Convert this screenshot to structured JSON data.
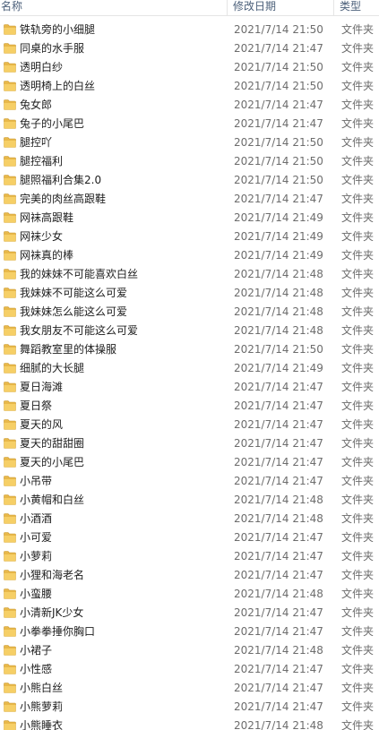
{
  "columns": {
    "name": "名称",
    "date_modified": "修改日期",
    "type": "类型"
  },
  "icon": "folder-icon",
  "folder_color": "#e8b84a",
  "rows": [
    {
      "name": "铁轨旁的小细腿",
      "date": "2021/7/14 21:50",
      "type": "文件夹"
    },
    {
      "name": "同桌的水手服",
      "date": "2021/7/14 21:47",
      "type": "文件夹"
    },
    {
      "name": "透明白纱",
      "date": "2021/7/14 21:50",
      "type": "文件夹"
    },
    {
      "name": "透明椅上的白丝",
      "date": "2021/7/14 21:50",
      "type": "文件夹"
    },
    {
      "name": "兔女郎",
      "date": "2021/7/14 21:47",
      "type": "文件夹"
    },
    {
      "name": "兔子的小尾巴",
      "date": "2021/7/14 21:47",
      "type": "文件夹"
    },
    {
      "name": "腿控吖",
      "date": "2021/7/14 21:50",
      "type": "文件夹"
    },
    {
      "name": "腿控福利",
      "date": "2021/7/14 21:50",
      "type": "文件夹"
    },
    {
      "name": "腿照福利合集2.0",
      "date": "2021/7/14 21:50",
      "type": "文件夹"
    },
    {
      "name": "完美的肉丝高跟鞋",
      "date": "2021/7/14 21:47",
      "type": "文件夹"
    },
    {
      "name": "网袜高跟鞋",
      "date": "2021/7/14 21:49",
      "type": "文件夹"
    },
    {
      "name": "网袜少女",
      "date": "2021/7/14 21:49",
      "type": "文件夹"
    },
    {
      "name": "网袜真的棒",
      "date": "2021/7/14 21:49",
      "type": "文件夹"
    },
    {
      "name": "我的妹妹不可能喜欢白丝",
      "date": "2021/7/14 21:48",
      "type": "文件夹"
    },
    {
      "name": "我妹妹不可能这么可爱",
      "date": "2021/7/14 21:48",
      "type": "文件夹"
    },
    {
      "name": "我妹妹怎么能这么可爱",
      "date": "2021/7/14 21:48",
      "type": "文件夹"
    },
    {
      "name": "我女朋友不可能这么可爱",
      "date": "2021/7/14 21:48",
      "type": "文件夹"
    },
    {
      "name": "舞蹈教室里的体操服",
      "date": "2021/7/14 21:50",
      "type": "文件夹"
    },
    {
      "name": "细腻的大长腿",
      "date": "2021/7/14 21:49",
      "type": "文件夹"
    },
    {
      "name": "夏日海滩",
      "date": "2021/7/14 21:47",
      "type": "文件夹"
    },
    {
      "name": "夏日祭",
      "date": "2021/7/14 21:47",
      "type": "文件夹"
    },
    {
      "name": "夏天的风",
      "date": "2021/7/14 21:47",
      "type": "文件夹"
    },
    {
      "name": "夏天的甜甜圈",
      "date": "2021/7/14 21:47",
      "type": "文件夹"
    },
    {
      "name": "夏天的小尾巴",
      "date": "2021/7/14 21:47",
      "type": "文件夹"
    },
    {
      "name": "小吊带",
      "date": "2021/7/14 21:47",
      "type": "文件夹"
    },
    {
      "name": "小黄帽和白丝",
      "date": "2021/7/14 21:48",
      "type": "文件夹"
    },
    {
      "name": "小酒酒",
      "date": "2021/7/14 21:48",
      "type": "文件夹"
    },
    {
      "name": "小可爱",
      "date": "2021/7/14 21:47",
      "type": "文件夹"
    },
    {
      "name": "小萝莉",
      "date": "2021/7/14 21:47",
      "type": "文件夹"
    },
    {
      "name": "小狸和海老名",
      "date": "2021/7/14 21:47",
      "type": "文件夹"
    },
    {
      "name": "小蛮腰",
      "date": "2021/7/14 21:48",
      "type": "文件夹"
    },
    {
      "name": "小清新JK少女",
      "date": "2021/7/14 21:47",
      "type": "文件夹"
    },
    {
      "name": "小拳拳捶你胸口",
      "date": "2021/7/14 21:47",
      "type": "文件夹"
    },
    {
      "name": "小裙子",
      "date": "2021/7/14 21:48",
      "type": "文件夹"
    },
    {
      "name": "小性感",
      "date": "2021/7/14 21:47",
      "type": "文件夹"
    },
    {
      "name": "小熊白丝",
      "date": "2021/7/14 21:47",
      "type": "文件夹"
    },
    {
      "name": "小熊萝莉",
      "date": "2021/7/14 21:47",
      "type": "文件夹"
    },
    {
      "name": "小熊睡衣",
      "date": "2021/7/14 21:48",
      "type": "文件夹"
    }
  ]
}
